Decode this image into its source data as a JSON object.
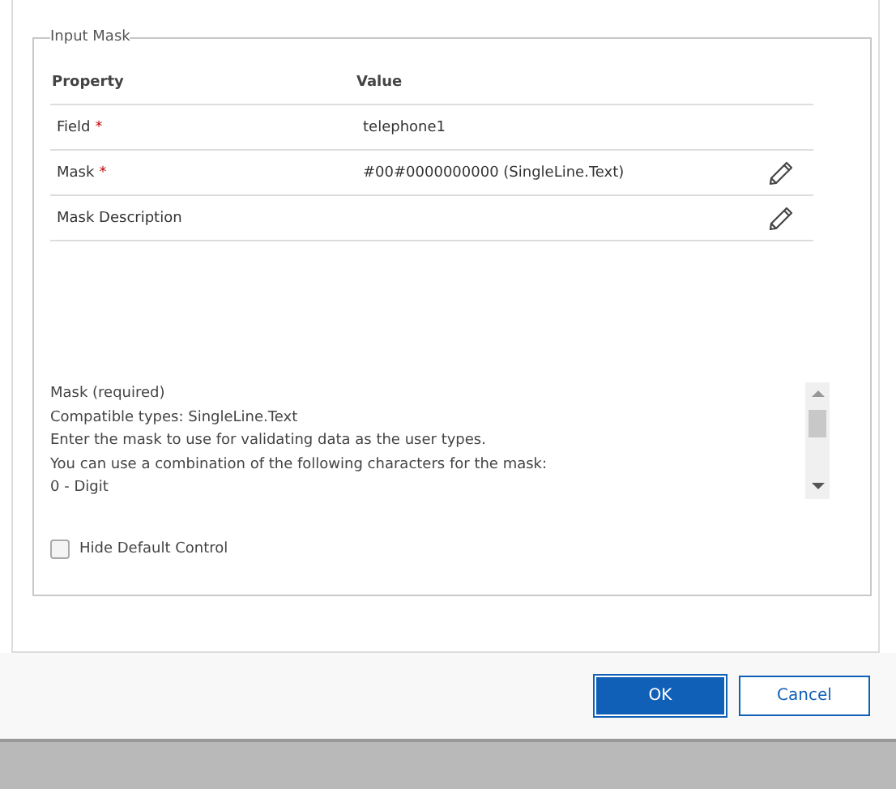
{
  "fieldset": {
    "legend": "Input Mask"
  },
  "table": {
    "columns": [
      "Property",
      "Value"
    ],
    "rows": [
      {
        "property": "Field",
        "required_marker": "*",
        "value": "telephone1",
        "editable": false
      },
      {
        "property": "Mask",
        "required_marker": "*",
        "value": "#00#0000000000 (SingleLine.Text)",
        "editable": true
      },
      {
        "property": "Mask Description",
        "value": "",
        "editable": true
      }
    ]
  },
  "description": [
    "Mask (required)",
    "Compatible types: SingleLine.Text",
    "Enter the mask to use for validating data as the user types.",
    "You can use a combination of the following characters for the mask:",
    "0 - Digit"
  ],
  "hide_default_control": {
    "label": "Hide Default Control",
    "checked": false
  },
  "buttons": [
    {
      "label": "OK",
      "kind": "primary"
    },
    {
      "label": "Cancel",
      "kind": "secondary"
    }
  ]
}
